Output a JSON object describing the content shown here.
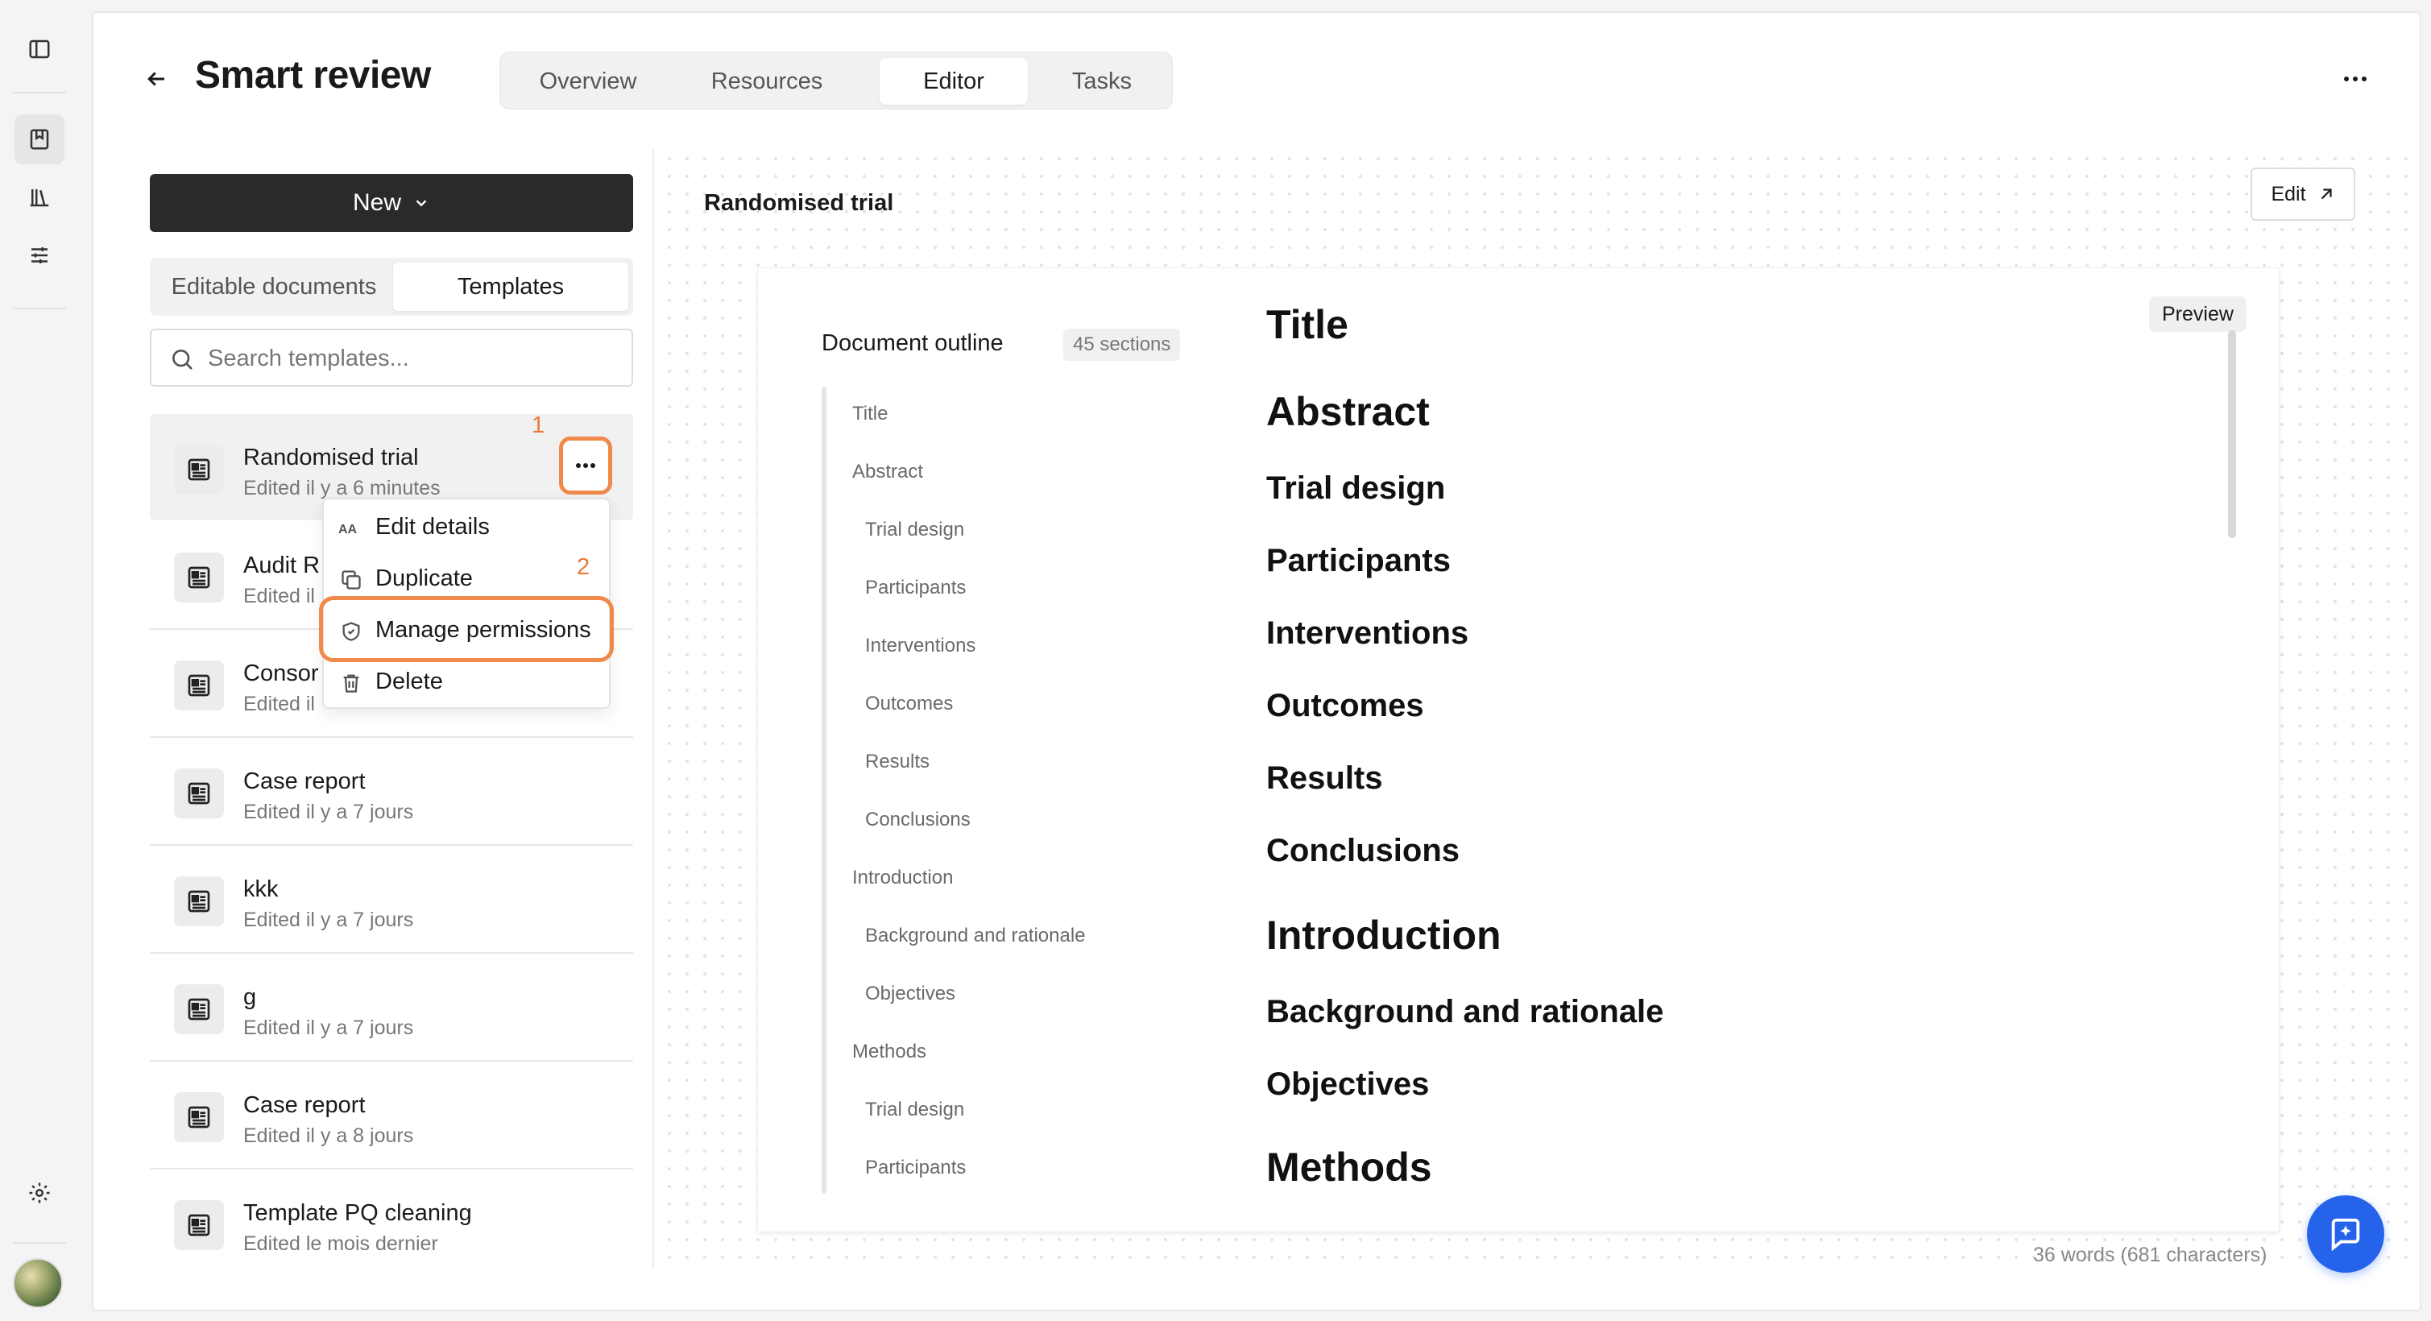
{
  "header": {
    "title": "Smart review",
    "tabs": [
      {
        "label": "Overview"
      },
      {
        "label": "Resources"
      },
      {
        "label": "Editor"
      },
      {
        "label": "Tasks"
      }
    ]
  },
  "left_panel": {
    "new_label": "New",
    "segments": [
      {
        "label": "Editable documents"
      },
      {
        "label": "Templates"
      }
    ],
    "search_placeholder": "Search templates...",
    "items": [
      {
        "name": "Randomised trial",
        "meta": "Edited il y a 6 minutes"
      },
      {
        "name": "Audit R",
        "meta": "Edited il"
      },
      {
        "name": "Consor",
        "meta": "Edited il"
      },
      {
        "name": "Case report",
        "meta": "Edited il y a 7 jours"
      },
      {
        "name": "kkk",
        "meta": "Edited il y a 7 jours"
      },
      {
        "name": "g",
        "meta": "Edited il y a 7 jours"
      },
      {
        "name": "Case report",
        "meta": "Edited il y a 8 jours"
      },
      {
        "name": "Template PQ cleaning",
        "meta": "Edited le mois dernier"
      }
    ]
  },
  "annotations": {
    "step1": "1",
    "step2": "2",
    "accent_color": "#ef8a4a"
  },
  "context_menu": {
    "items": [
      {
        "label": "Edit details",
        "icon": "text-size-icon"
      },
      {
        "label": "Duplicate",
        "icon": "duplicate-icon"
      },
      {
        "label": "Manage permissions",
        "icon": "shield-icon"
      },
      {
        "label": "Delete",
        "icon": "trash-icon"
      }
    ]
  },
  "editor": {
    "doc_title": "Randomised trial",
    "edit_label": "Edit",
    "outline_title": "Document outline",
    "sections_badge": "45 sections",
    "outline": [
      "Title",
      "Abstract",
      "Trial design",
      "Participants",
      "Interventions",
      "Outcomes",
      "Results",
      "Conclusions",
      "Introduction",
      "Background and rationale",
      "Objectives",
      "Methods",
      "Trial design",
      "Participants"
    ],
    "preview_label": "Preview",
    "preview_headings": [
      "Title",
      "Abstract",
      "Trial design",
      "Participants",
      "Interventions",
      "Outcomes",
      "Results",
      "Conclusions",
      "Introduction",
      "Background and rationale",
      "Objectives",
      "Methods"
    ],
    "word_count": "36 words  (681 characters)"
  }
}
